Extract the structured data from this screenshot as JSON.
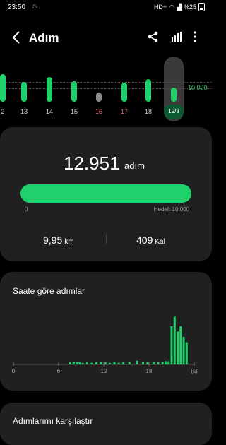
{
  "status_bar": {
    "time": "23:50",
    "network": "HD+",
    "battery": "%25"
  },
  "app_bar": {
    "title": "Adım",
    "icons": [
      "back-arrow-icon",
      "share-icon",
      "chart-bars-icon",
      "more-vertical-icon"
    ]
  },
  "day_strip": {
    "goal_label": "10.000",
    "goal_steps": 10000,
    "days": [
      {
        "label": "2",
        "fraction": 1.4,
        "color": "#1fd16a",
        "label_color": "#d6d6d6"
      },
      {
        "label": "13",
        "fraction": 1.0,
        "color": "#1fd16a",
        "label_color": "#d6d6d6"
      },
      {
        "label": "14",
        "fraction": 1.25,
        "color": "#1fd16a",
        "label_color": "#d6d6d6"
      },
      {
        "label": "15",
        "fraction": 1.05,
        "color": "#1fd16a",
        "label_color": "#d6d6d6"
      },
      {
        "label": "16",
        "fraction": 0.45,
        "color": "#8a8a8a",
        "label_color": "#e86a6a"
      },
      {
        "label": "17",
        "fraction": 0.95,
        "color": "#1fd16a",
        "label_color": "#e86a6a"
      },
      {
        "label": "18",
        "fraction": 1.15,
        "color": "#1fd16a",
        "label_color": "#d6d6d6"
      },
      {
        "label": "19/8",
        "fraction": 0.7,
        "color": "#1fd16a",
        "label_color": "#ffffff",
        "selected": true
      }
    ]
  },
  "summary": {
    "steps": "12.951",
    "steps_unit": "adım",
    "progress_fraction": 1.0,
    "progress_min": "0",
    "goal_text": "Hedef: 10.000",
    "distance_value": "9,95",
    "distance_unit": "km",
    "calories_value": "409",
    "calories_unit": "Kal"
  },
  "hourly": {
    "title": "Saate göre adımlar"
  },
  "chart_data": {
    "type": "bar",
    "title": "Saate göre adımlar",
    "x_ticks": [
      "0",
      "6",
      "12",
      "18",
      "(s)"
    ],
    "xlim": [
      0,
      24
    ],
    "ylim": [
      0,
      1
    ],
    "values": [
      [
        7.5,
        0.04
      ],
      [
        8,
        0.05
      ],
      [
        8.4,
        0.04
      ],
      [
        8.8,
        0.05
      ],
      [
        9.2,
        0.03
      ],
      [
        9.8,
        0.05
      ],
      [
        10.4,
        0.03
      ],
      [
        11,
        0.04
      ],
      [
        11.6,
        0.05
      ],
      [
        12.2,
        0.04
      ],
      [
        12.8,
        0.03
      ],
      [
        13.4,
        0.05
      ],
      [
        14,
        0.03
      ],
      [
        14.6,
        0.04
      ],
      [
        15.4,
        0.05
      ],
      [
        16.4,
        0.07
      ],
      [
        17.2,
        0.05
      ],
      [
        17.8,
        0.04
      ],
      [
        18.6,
        0.05
      ],
      [
        19.2,
        0.04
      ],
      [
        19.8,
        0.05
      ],
      [
        20.2,
        0.06
      ],
      [
        20.6,
        0.06
      ],
      [
        21,
        0.72
      ],
      [
        21.4,
        0.9
      ],
      [
        21.8,
        0.62
      ],
      [
        22.2,
        0.72
      ],
      [
        22.6,
        0.52
      ],
      [
        23,
        0.42
      ]
    ]
  },
  "compare": {
    "title": "Adımlarımı karşılaştır"
  }
}
